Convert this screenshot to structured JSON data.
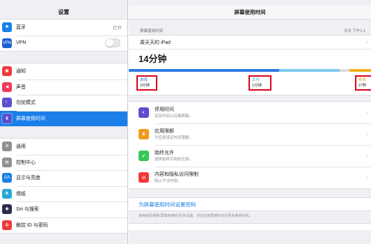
{
  "sidebar": {
    "title": "设置",
    "groups": [
      [
        {
          "label": "蓝牙",
          "value": "打开",
          "icon": "bluetooth-icon",
          "color": "#1a7fe8",
          "glyph": "✱"
        },
        {
          "label": "VPN",
          "toggle": "off",
          "icon": "vpn-icon",
          "color": "#1a5fd0",
          "glyph": "VPN"
        }
      ],
      [
        {
          "label": "通知",
          "icon": "notifications-icon",
          "color": "#f0383a",
          "glyph": "▣"
        },
        {
          "label": "声音",
          "icon": "sound-icon",
          "color": "#f03a58",
          "glyph": "◀"
        },
        {
          "label": "勿扰模式",
          "icon": "moon-icon",
          "color": "#5b4fd0",
          "glyph": "☾"
        },
        {
          "label": "屏幕使用时间",
          "icon": "hourglass-icon",
          "color": "#5b4fd0",
          "glyph": "⧗",
          "selected": true
        }
      ],
      [
        {
          "label": "通用",
          "icon": "gear-icon",
          "color": "#8e8e93",
          "glyph": "⚙"
        },
        {
          "label": "控制中心",
          "icon": "control-center-icon",
          "color": "#8e8e93",
          "glyph": "▤"
        },
        {
          "label": "显示与亮度",
          "icon": "display-brightness-icon",
          "color": "#1a7fe8",
          "glyph": "AA"
        },
        {
          "label": "墙纸",
          "icon": "wallpaper-icon",
          "color": "#2aa7d6",
          "glyph": "❀"
        },
        {
          "label": "Siri 与搜索",
          "icon": "siri-icon",
          "color": "#2b2b4e",
          "glyph": "◉"
        },
        {
          "label": "触控 ID 与密码",
          "icon": "fingerprint-icon",
          "color": "#f0383a",
          "glyph": "◍"
        }
      ]
    ]
  },
  "detail": {
    "title": "屏幕使用时间",
    "section_label": "屏幕使用时间",
    "timestamp": "今天 下午1:1",
    "device_name": "周天天的 iPad",
    "total": "14分钟",
    "usage_fractions": {
      "games": 0.62,
      "other": 0.25,
      "reading": 0.09
    },
    "categories": {
      "games": {
        "name": "游戏",
        "value": "3分钟",
        "color": "#2f7ae5"
      },
      "other": {
        "name": "其他",
        "value": "1分钟",
        "color": "#7ec8f0"
      },
      "reading": {
        "name": "效率",
        "value": "27秒",
        "color": "#f2b01e"
      }
    },
    "limits": [
      {
        "title": "停用时间",
        "desc": "设定时间以远离屏幕。",
        "icon": "downtime-icon",
        "color": "#5b4fd0",
        "glyph": "◐"
      },
      {
        "title": "应用限额",
        "desc": "为应用设定时间限额。",
        "icon": "app-limits-icon",
        "color": "#f29a1a",
        "glyph": "⧗"
      },
      {
        "title": "始终允许",
        "desc": "选择始终可用的应用。",
        "icon": "always-allowed-icon",
        "color": "#34c759",
        "glyph": "✔"
      },
      {
        "title": "内容和隐私访问限制",
        "desc": "阻止不当内容。",
        "icon": "restrictions-icon",
        "color": "#f0383a",
        "glyph": "⊘"
      }
    ],
    "passcode_label": "为屏幕使用时间设置密码",
    "passcode_footer": "使用密码保障“屏幕使用时间”的设置，并在达到限额时允许更多使用时间。"
  }
}
